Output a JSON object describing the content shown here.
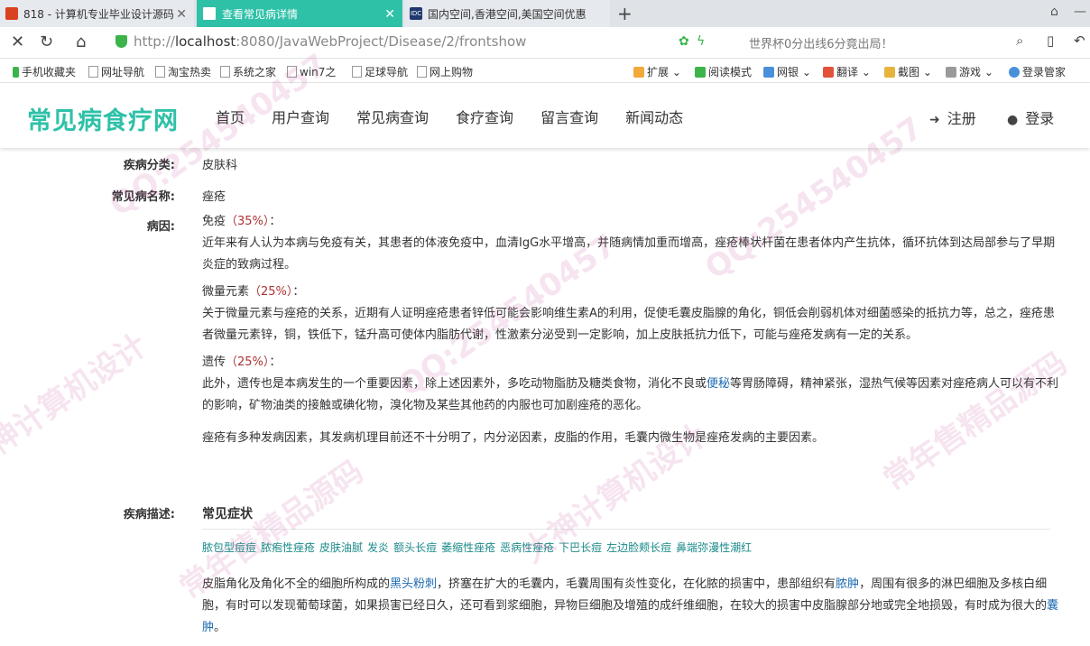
{
  "browser": {
    "tabs": [
      {
        "title": "818 - 计算机专业毕业设计源码"
      },
      {
        "title": "查看常见病详情"
      },
      {
        "title": "国内空间,香港空间,美国空间优惠"
      }
    ],
    "url_prefix": "http://",
    "url_host": "localhost",
    "url_path": ":8080/JavaWebProject/Disease/2/frontshow",
    "news_text": "世界杯0分出线6分竟出局！",
    "bookmarks_left": [
      "手机收藏夹",
      "网址导航",
      "淘宝热卖",
      "系统之家",
      "win7之",
      "足球导航",
      "网上购物"
    ],
    "bookmarks_right": [
      "扩展",
      "阅读模式",
      "网银",
      "翻译",
      "截图",
      "游戏",
      "登录管家"
    ]
  },
  "site": {
    "logo": "常见病食疗网",
    "nav": [
      "首页",
      "用户查询",
      "常见病查询",
      "食疗查询",
      "留言查询",
      "新闻动态"
    ],
    "register": "注册",
    "login": "登录"
  },
  "detail": {
    "category_label": "疾病分类:",
    "category_value": "皮肤科",
    "name_label": "常见病名称:",
    "name_value": "痤疮",
    "cause_label": "病因:",
    "causes": [
      {
        "head": "免疫",
        "pct": "（35%）",
        "tail": "：",
        "text": "近年来有人认为本病与免疫有关，其患者的体液免疫中，血清IgG水平增高，并随病情加重而增高，痤疮棒状杆菌在患者体内产生抗体，循环抗体到达局部参与了早期炎症的致病过程。"
      },
      {
        "head": "微量元素",
        "pct": "（25%）",
        "tail": "：",
        "text": "关于微量元素与痤疮的关系，近期有人证明痤疮患者锌低可能会影响维生素A的利用，促使毛囊皮脂腺的角化，铜低会削弱机体对细菌感染的抵抗力等，总之，痤疮患者微量元素锌，铜，铁低下，锰升高可使体内脂肪代谢，性激素分泌受到一定影响，加上皮肤抵抗力低下，可能与痤疮发病有一定的关系。"
      },
      {
        "head": "遗传",
        "pct": "（25%）",
        "tail": "：",
        "text_a": "此外，遗传也是本病发生的一个重要因素，除上述因素外，多吃动物脂肪及糖类食物，消化不良或",
        "link": "便秘",
        "text_b": "等胃肠障碍，精神紧张，湿热气候等因素对痤疮病人可以有不利的影响，矿物油类的接触或碘化物，溴化物及某些其他药的内服也可加剧痤疮的恶化。"
      }
    ],
    "cause_summary": "痤疮有多种发病因素，其发病机理目前还不十分明了，内分泌因素，皮脂的作用，毛囊内微生物是痤疮发病的主要因素。",
    "desc_label": "疾病描述:",
    "symptom_title": "常见症状",
    "symptom_tags": [
      "脓包型痘痘",
      "脓疱性痤疮",
      "皮肤油腻",
      "发炎",
      "额头长痘",
      "萎缩性痤疮",
      "恶病性痤疮",
      "下巴长痘",
      "左边脸颊长痘",
      "鼻端弥漫性潮红"
    ],
    "desc_a": "皮脂角化及角化不全的细胞所构成的",
    "desc_link1": "黑头粉刺",
    "desc_b": "，挤塞在扩大的毛囊内，毛囊周围有炎性变化，在化脓的损害中，患部组织有",
    "desc_link2": "脓肿",
    "desc_c": "，周围有很多的淋巴细胞及多核白细胞，有时可以发现葡萄球菌，如果损害已经日久，还可看到浆细胞，异物巨细胞及增殖的成纤维细胞，在较大的损害中皮脂腺部分地或完全地损毁，有时成为很大的",
    "desc_link3": "囊肿",
    "desc_d": "。"
  },
  "watermark": [
    "QQ:254540457",
    "大神计算机设计",
    "常年售精品源码"
  ],
  "colors": {
    "accent": "#2fc1a8",
    "link": "#1d6bb3",
    "tag": "#1d8a8a"
  }
}
